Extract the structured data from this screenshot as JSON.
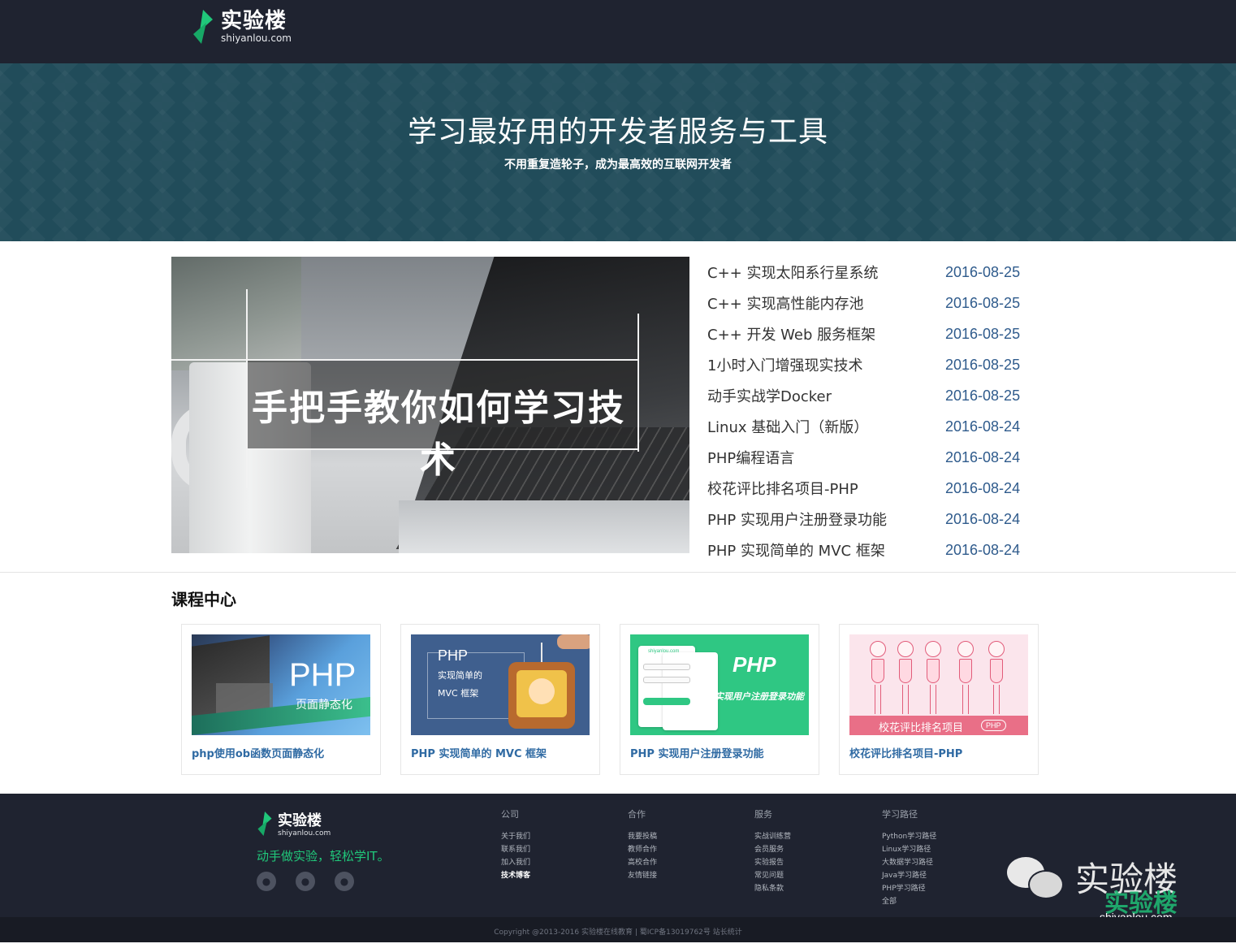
{
  "brand": {
    "name_cn": "实验楼",
    "name_en": "shiyanlou.com",
    "accent": "#20c77a"
  },
  "banner": {
    "title": "学习最好用的开发者服务与工具",
    "subtitle": "不用重复造轮子，成为最高效的互联网开发者",
    "bg_color": "#214c5a"
  },
  "hero": {
    "caption": "手把手教你如何学习技术"
  },
  "news": [
    {
      "title": "C++ 实现太阳系行星系统",
      "date": "2016-08-25"
    },
    {
      "title": "C++ 实现高性能内存池",
      "date": "2016-08-25"
    },
    {
      "title": "C++ 开发 Web 服务框架",
      "date": "2016-08-25"
    },
    {
      "title": "1小时入门增强现实技术",
      "date": "2016-08-25"
    },
    {
      "title": "动手实战学Docker",
      "date": "2016-08-25"
    },
    {
      "title": "Linux 基础入门（新版）",
      "date": "2016-08-24"
    },
    {
      "title": "PHP编程语言",
      "date": "2016-08-24"
    },
    {
      "title": "校花评比排名项目-PHP",
      "date": "2016-08-24"
    },
    {
      "title": "PHP 实现用户注册登录功能",
      "date": "2016-08-24"
    },
    {
      "title": "PHP 实现简单的 MVC 框架",
      "date": "2016-08-24"
    }
  ],
  "courses": {
    "section_title": "课程中心",
    "items": [
      {
        "title": "php使用ob函数页面静态化",
        "thumb_big": "PHP",
        "thumb_small": "页面静态化"
      },
      {
        "title": "PHP 实现简单的 MVC 框架",
        "thumb_big": "PHP",
        "thumb_l1": "实现简单的",
        "thumb_l2": "MVC 框架"
      },
      {
        "title": "PHP 实现用户注册登录功能",
        "thumb_big": "PHP",
        "thumb_sub": "实现用户注册登录功能",
        "thumb_site": "shiyanlou.com"
      },
      {
        "title": "校花评比排名项目-PHP",
        "thumb_banner": "校花评比排名项目",
        "thumb_tag": "PHP"
      }
    ]
  },
  "footer": {
    "slogan": "动手做实验，轻松学IT。",
    "social_icons": [
      "wechat-icon",
      "qq-icon",
      "weibo-icon"
    ],
    "columns": [
      {
        "head": "公司",
        "items": [
          "关于我们",
          "联系我们",
          "加入我们",
          "技术博客"
        ]
      },
      {
        "head": "合作",
        "items": [
          "我要投稿",
          "教师合作",
          "高校合作",
          "友情链接"
        ]
      },
      {
        "head": "服务",
        "items": [
          "实战训练营",
          "会员服务",
          "实验报告",
          "常见问题",
          "隐私条款"
        ]
      },
      {
        "head": "学习路径",
        "items": [
          "Python学习路径",
          "Linux学习路径",
          "大数据学习路径",
          "Java学习路径",
          "PHP学习路径",
          "全部"
        ]
      }
    ],
    "copyright": "Copyright @2013-2016 实验楼在线教育 | 蜀ICP备13019762号 站长统计"
  },
  "watermark": {
    "text": "实验楼",
    "brand": "实验楼",
    "url": "shiyanlou.com"
  }
}
